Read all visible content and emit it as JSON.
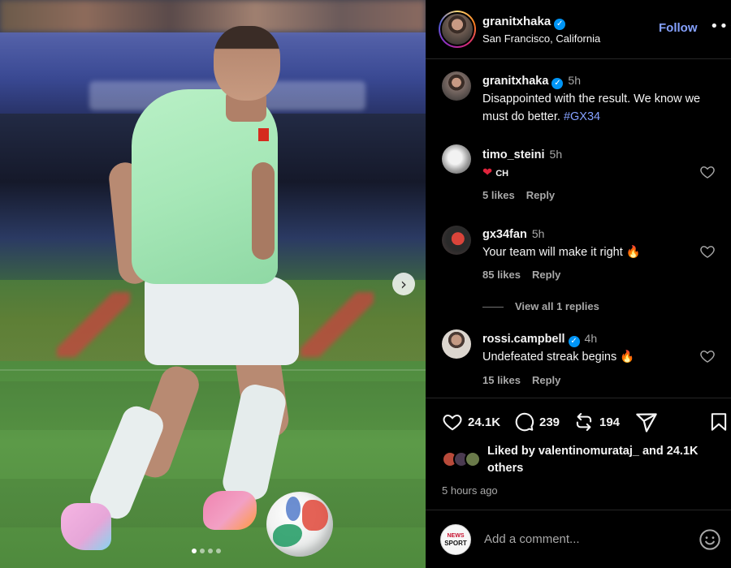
{
  "post": {
    "author": "granitxhaka",
    "location": "San Francisco, California",
    "follow_label": "Follow",
    "more_label": "•••",
    "caption_time": "5h",
    "caption_text": "Disappointed with the result. We know we must do better.",
    "hashtag": "#GX34"
  },
  "carousel": {
    "next_icon": "chevron-right-icon",
    "next_label": "›",
    "slide_count": 4,
    "active_slide": 1
  },
  "comments": [
    {
      "user": "timo_steini",
      "time": "5h",
      "text": "CH",
      "emoji": "❤",
      "likes": "5 likes",
      "reply": "Reply"
    },
    {
      "user": "gx34fan",
      "time": "5h",
      "text": "Your team will make it right",
      "emoji": "🔥",
      "likes": "85 likes",
      "reply": "Reply",
      "view_replies": "View all 1 replies"
    },
    {
      "user": "rossi.campbell",
      "time": "4h",
      "text": "Undefeated streak begins",
      "emoji": "🔥",
      "likes": "15 likes",
      "reply": "Reply"
    }
  ],
  "actions": {
    "likes": "24.1K",
    "comments": "239",
    "reposts": "194"
  },
  "liked_by": {
    "prefix": "Liked by",
    "user": "valentinomurataj_",
    "and": "and",
    "others": "24.1K others"
  },
  "posted_ago": "5 hours ago",
  "comment_box": {
    "avatar_top": "NEWS",
    "avatar_bottom": "SPORT",
    "placeholder": "Add a comment..."
  },
  "colors": {
    "accent": "#85a1ff",
    "verified": "#0095f6",
    "muted": "#a8a8a8",
    "background": "#000000"
  }
}
